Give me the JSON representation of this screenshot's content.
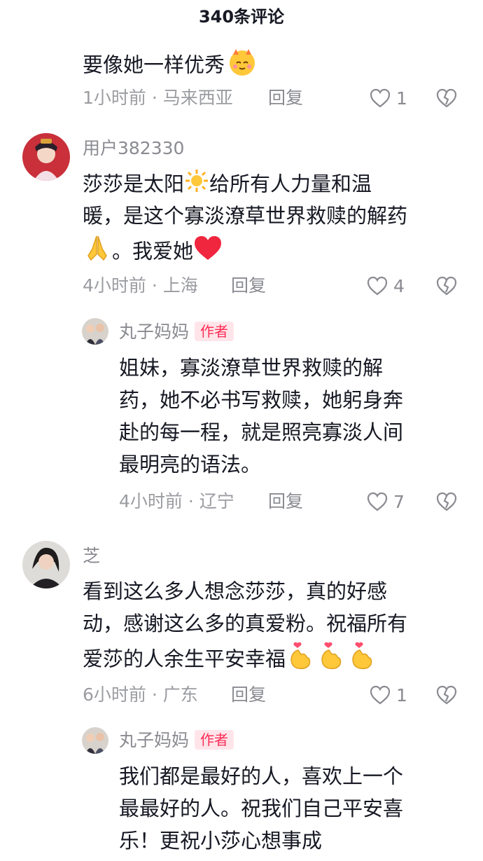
{
  "header": {
    "title": "340条评论"
  },
  "comments": [
    {
      "text": "要像她一样优秀",
      "time": "1小时前",
      "location": "马来西亚",
      "reply_label": "回复",
      "likes": "1"
    },
    {
      "username": "用户382330",
      "text_lines": [
        "莎莎是太阳",
        "给所有人力量和温",
        "暖，是这个寡淡潦草世界救赎的解药",
        "。我爱她"
      ],
      "time": "4小时前",
      "location": "上海",
      "reply_label": "回复",
      "likes": "4"
    },
    {
      "username": "丸子妈妈",
      "badge": "作者",
      "text_lines": [
        "姐妹，寡淡潦草世界救赎的解",
        "药，她不必书写救赎，她躬身奔",
        "赴的每一程，就是照亮寡淡人间",
        "最明亮的语法。"
      ],
      "time": "4小时前",
      "location": "辽宁",
      "reply_label": "回复",
      "likes": "7"
    },
    {
      "username": "芝",
      "text_lines": [
        "看到这么多人想念莎莎，真的好感",
        "动，感谢这么多的真爱粉。祝福所有",
        "爱莎的人余生平安幸福"
      ],
      "time": "6小时前",
      "location": "广东",
      "reply_label": "回复",
      "likes": "1"
    },
    {
      "username": "丸子妈妈",
      "badge": "作者",
      "text_lines": [
        "我们都是最好的人，喜欢上一个",
        "最最好的人。祝我们自己平安喜",
        "乐！更祝小莎心想事成"
      ]
    }
  ],
  "colors": {
    "accent": "#fe2c55",
    "meta": "#9b9ca1",
    "text": "#161823"
  }
}
